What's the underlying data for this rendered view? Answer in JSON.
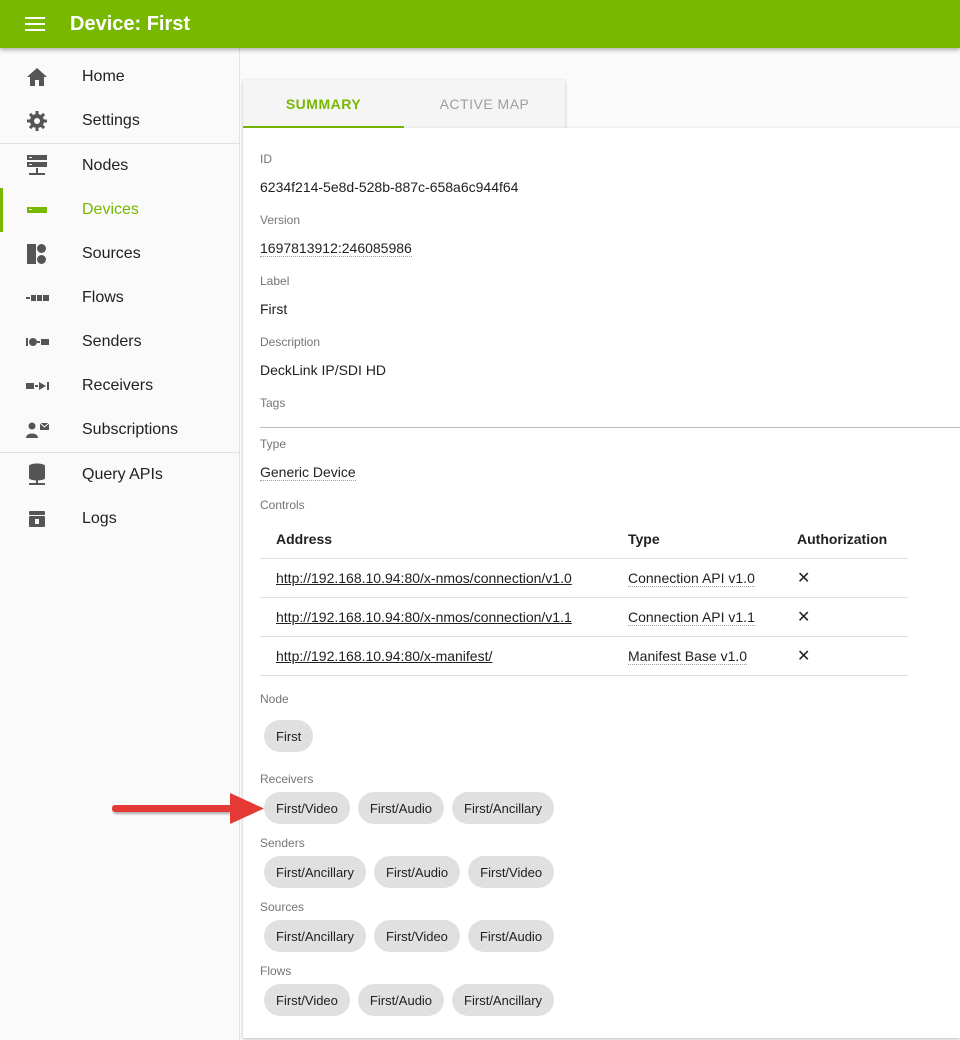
{
  "appbar": {
    "title": "Device: First",
    "menu_icon": "menu-icon",
    "background": "#78b800"
  },
  "sidebar": {
    "items": [
      {
        "label": "Home",
        "icon": "home-icon"
      },
      {
        "label": "Settings",
        "icon": "gear-icon"
      },
      {
        "label": "Nodes",
        "icon": "nodes-icon"
      },
      {
        "label": "Devices",
        "icon": "devices-icon",
        "active": true
      },
      {
        "label": "Sources",
        "icon": "sources-icon"
      },
      {
        "label": "Flows",
        "icon": "flows-icon"
      },
      {
        "label": "Senders",
        "icon": "senders-icon"
      },
      {
        "label": "Receivers",
        "icon": "receivers-icon"
      },
      {
        "label": "Subscriptions",
        "icon": "subscriptions-icon"
      },
      {
        "label": "Query APIs",
        "icon": "database-icon"
      },
      {
        "label": "Logs",
        "icon": "logs-icon"
      }
    ]
  },
  "tabs": [
    {
      "label": "SUMMARY",
      "active": true
    },
    {
      "label": "ACTIVE MAP",
      "active": false
    }
  ],
  "summary": {
    "id_label": "ID",
    "id_value": "6234f214-5e8d-528b-887c-658a6c944f64",
    "version_label": "Version",
    "version_value": "1697813912:246085986",
    "label_label": "Label",
    "label_value": "First",
    "description_label": "Description",
    "description_value": "DeckLink IP/SDI HD",
    "tags_label": "Tags",
    "type_label": "Type",
    "type_value": "Generic Device",
    "controls_label": "Controls"
  },
  "controls": {
    "headers": [
      "Address",
      "Type",
      "Authorization"
    ],
    "rows": [
      {
        "address": "http://192.168.10.94:80/x-nmos/connection/v1.0",
        "type": "Connection API v1.0",
        "authorization": "✕"
      },
      {
        "address": "http://192.168.10.94:80/x-nmos/connection/v1.1",
        "type": "Connection API v1.1",
        "authorization": "✕"
      },
      {
        "address": "http://192.168.10.94:80/x-manifest/",
        "type": "Manifest Base v1.0",
        "authorization": "✕"
      }
    ]
  },
  "relations": {
    "node_label": "Node",
    "node": [
      "First"
    ],
    "receivers_label": "Receivers",
    "receivers": [
      "First/Video",
      "First/Audio",
      "First/Ancillary"
    ],
    "senders_label": "Senders",
    "senders": [
      "First/Ancillary",
      "First/Audio",
      "First/Video"
    ],
    "sources_label": "Sources",
    "sources": [
      "First/Ancillary",
      "First/Video",
      "First/Audio"
    ],
    "flows_label": "Flows",
    "flows": [
      "First/Video",
      "First/Audio",
      "First/Ancillary"
    ]
  },
  "colors": {
    "accent": "#78b800",
    "annotation_arrow": "#e53935"
  }
}
